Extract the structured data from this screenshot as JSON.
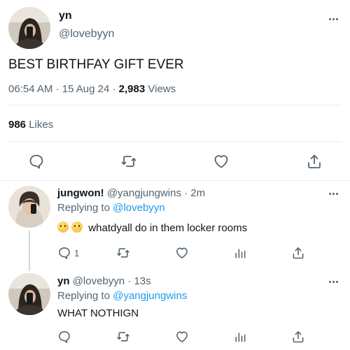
{
  "tweet": {
    "author_name": "yn",
    "author_handle": "@lovebyyn",
    "text": "BEST BIRTHFAY GIFT EVER",
    "time": "06:54 AM",
    "sep1": "·",
    "date": "15 Aug 24",
    "sep2": "·",
    "views_count": "2,983",
    "views_label": "Views",
    "likes_count": "986",
    "likes_label": "Likes"
  },
  "replies": [
    {
      "name": "jungwon!",
      "handle": "@yangjungwins",
      "sep": "·",
      "age": "2m",
      "replying_label": "Replying to",
      "replying_handle": "@lovebyyn",
      "text": "whatdyall do in them locker rooms",
      "reply_count": "1"
    },
    {
      "name": "yn",
      "handle": "@lovebyyn",
      "sep": "·",
      "age": "13s",
      "replying_label": "Replying to",
      "replying_handle": "@yangjungwins",
      "text": "WHAT NOTHIGN"
    }
  ],
  "icons": {
    "more": "more-horizontal-icon",
    "reply": "comment-icon",
    "retweet": "retweet-icon",
    "like": "heart-icon",
    "share": "share-icon",
    "analytics": "analytics-icon",
    "emoji": "emoji-icon"
  },
  "colors": {
    "text": "#0f1419",
    "muted": "#536471",
    "link": "#1d9bf0",
    "divider": "#e6ecf0"
  }
}
